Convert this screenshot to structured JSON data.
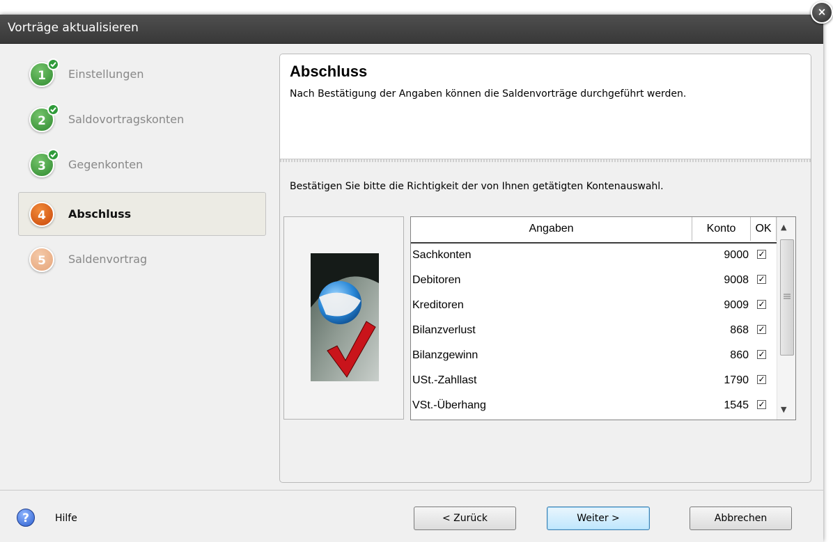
{
  "window": {
    "title": "Vorträge aktualisieren",
    "close_glyph": "×"
  },
  "steps": [
    {
      "number": "1",
      "label": "Einstellungen",
      "state": "done"
    },
    {
      "number": "2",
      "label": "Saldovortragskonten",
      "state": "done"
    },
    {
      "number": "3",
      "label": "Gegenkonten",
      "state": "done"
    },
    {
      "number": "4",
      "label": "Abschluss",
      "state": "active"
    },
    {
      "number": "5",
      "label": "Saldenvortrag",
      "state": "pending"
    }
  ],
  "panel": {
    "title": "Abschluss",
    "subtitle": "Nach Bestätigung der Angaben können die Saldenvorträge durchgeführt werden.",
    "instruction": "Bestätigen Sie bitte die Richtigkeit der von Ihnen getätigten Kontenauswahl."
  },
  "table": {
    "columns": [
      "Angaben",
      "Konto",
      "OK"
    ],
    "rows": [
      {
        "angaben": "Sachkonten",
        "konto": "9000",
        "ok": true
      },
      {
        "angaben": "Debitoren",
        "konto": "9008",
        "ok": true
      },
      {
        "angaben": "Kreditoren",
        "konto": "9009",
        "ok": true
      },
      {
        "angaben": "Bilanzverlust",
        "konto": "868",
        "ok": true
      },
      {
        "angaben": "Bilanzgewinn",
        "konto": "860",
        "ok": true
      },
      {
        "angaben": "USt.-Zahllast",
        "konto": "1790",
        "ok": true
      },
      {
        "angaben": "VSt.-Überhang",
        "konto": "1545",
        "ok": true
      }
    ],
    "check_glyph": "✓",
    "scroll_up_glyph": "▲",
    "scroll_down_glyph": "▼"
  },
  "footer": {
    "help_glyph": "?",
    "help_label": "Hilfe",
    "back_label": "< Zurück",
    "next_label": "Weiter >",
    "cancel_label": "Abbrechen"
  },
  "icons": {
    "close": "close-icon",
    "help": "help-icon",
    "step_done": "check-badge-icon",
    "illustration": "golf-ball-checkmark-image"
  },
  "colors": {
    "titlebar": "#3f3f3f",
    "step_done": "#3a9a3a",
    "step_active": "#e0641a",
    "step_pending": "#f0b48c",
    "default_button": "#bee6fd"
  }
}
